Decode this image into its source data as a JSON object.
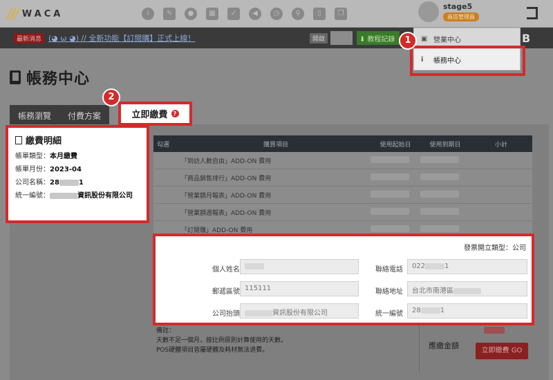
{
  "header": {
    "logo_text": "WACA",
    "user_name": "stage5",
    "user_badge": "商店管理員"
  },
  "newsbar": {
    "tag": "最新消息",
    "text": "(◕ ω ◕) // 全新功能【訂閱購】正式上線！",
    "toggle_label": "開啟",
    "download_label": "教程記錄"
  },
  "dropdown": {
    "items": [
      {
        "label": "營業中心",
        "icon": "panel-icon"
      },
      {
        "label": "帳務中心",
        "icon": "info-icon"
      }
    ],
    "partial_text": "B"
  },
  "page": {
    "title": "帳務中心",
    "tabs": [
      "帳務瀏覽",
      "付費方案",
      "立即繳費"
    ]
  },
  "detail": {
    "title": "繳費明細",
    "rows": [
      {
        "label": "帳單類型：",
        "value": "本月繳費"
      },
      {
        "label": "帳單月份：",
        "value": "2023-04"
      },
      {
        "label": "公司名稱：",
        "value_prefix": "28",
        "value_suffix": "1"
      },
      {
        "label": "統一編號：",
        "value_suffix": "資訊股份有限公司"
      }
    ]
  },
  "table": {
    "headers": [
      "勾選",
      "購買項目",
      "使用起始日",
      "使用到期日",
      "小計"
    ],
    "rows": [
      "「到訪人數自由」ADD-ON 費用",
      "「商品銷售排行」ADD-ON 費用",
      "「營業額月報表」ADD-ON 費用",
      "「營業額週報表」ADD-ON 費用",
      "「訂閱購」ADD-ON 費用"
    ]
  },
  "invoice": {
    "type_label": "發票開立類型：公司",
    "fields": {
      "name": {
        "label": "個人姓名",
        "value": ""
      },
      "phone": {
        "label": "聯絡電話",
        "value_prefix": "022",
        "value_suffix": "1"
      },
      "postal": {
        "label": "郵遞區號",
        "value": "115111"
      },
      "address": {
        "label": "聯絡地址",
        "value": "台北市南港區"
      },
      "company": {
        "label": "公司抬頭",
        "value": "資訊股份有限公司"
      },
      "taxid": {
        "label": "統一編號",
        "value_prefix": "28",
        "value_suffix": "1"
      }
    }
  },
  "footer": {
    "note_lines": [
      "備註：",
      "天數不足一個月，按比例原則計算使用的天數。",
      "POS硬體項目皆屬硬體及耗材無法退費。"
    ],
    "pay_label": "應繳金額",
    "pay_button": "立即繳費 GO"
  },
  "steps": [
    "1",
    "2"
  ],
  "colors": {
    "highlight": "#d42a2a",
    "header_bg": "#b9b9b9",
    "news_bg": "#3a3a3a",
    "table_header_bg": "#2a2f36"
  }
}
